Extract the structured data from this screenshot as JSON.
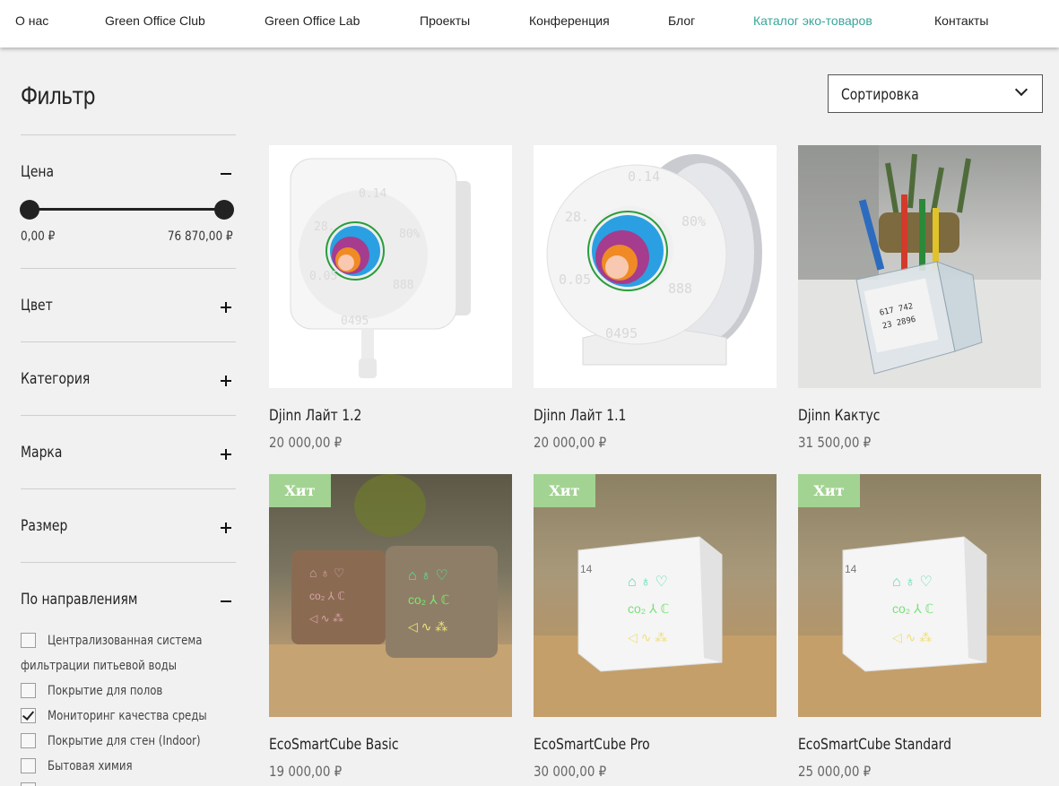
{
  "nav": {
    "items": [
      "О нас",
      "Green Office Club",
      "Green Office Lab",
      "Проекты",
      "Конференция",
      "Блог",
      "Каталог эко-товаров",
      "Контакты"
    ],
    "active_index": 6,
    "active_color": "#3aa59a"
  },
  "filter": {
    "title": "Фильтр",
    "price": {
      "label": "Цена",
      "min": "0,00 ₽",
      "max": "76 870,00 ₽",
      "expanded": true
    },
    "sections": [
      {
        "label": "Цвет",
        "expanded": false
      },
      {
        "label": "Категория",
        "expanded": false
      },
      {
        "label": "Марка",
        "expanded": false
      },
      {
        "label": "Размер",
        "expanded": false
      }
    ],
    "directions": {
      "label": "По направлениям",
      "expanded": true,
      "options": [
        {
          "label_line1": "Централизованная система",
          "label_line2": "фильтрации питьевой воды",
          "checked": false
        },
        {
          "label_line1": "Покрытие для полов",
          "checked": false
        },
        {
          "label_line1": "Мониторинг качества среды",
          "checked": true
        },
        {
          "label_line1": "Покрытие для стен (Indoor)",
          "checked": false
        },
        {
          "label_line1": "Бытовая химия",
          "checked": false
        }
      ]
    }
  },
  "sort": {
    "label": "Сортировка"
  },
  "products": [
    {
      "name": "Djinn Лайт 1.2",
      "price": "20 000,00 ₽",
      "badge": "",
      "image": "air-quality-monitor-square-white"
    },
    {
      "name": "Djinn Лайт 1.1",
      "price": "20 000,00 ₽",
      "badge": "",
      "image": "air-quality-monitor-round-stand"
    },
    {
      "name": "Djinn Кактус",
      "price": "31 500,00 ₽",
      "badge": "",
      "image": "pen-holder-eink-monitor-photo"
    },
    {
      "name": "EcoSmartCube Basic",
      "price": "19 000,00 ₽",
      "badge": "Хит",
      "image": "two-wooden-cubes-photo"
    },
    {
      "name": "EcoSmartCube Pro",
      "price": "30 000,00 ₽",
      "badge": "Хит",
      "image": "white-cube-photo"
    },
    {
      "name": "EcoSmartCube Standard",
      "price": "25 000,00 ₽",
      "badge": "Хит",
      "image": "white-cube-photo"
    }
  ],
  "colors": {
    "badge": "#a3d392",
    "background": "#f1f1f1",
    "accent": "#3aa59a"
  }
}
